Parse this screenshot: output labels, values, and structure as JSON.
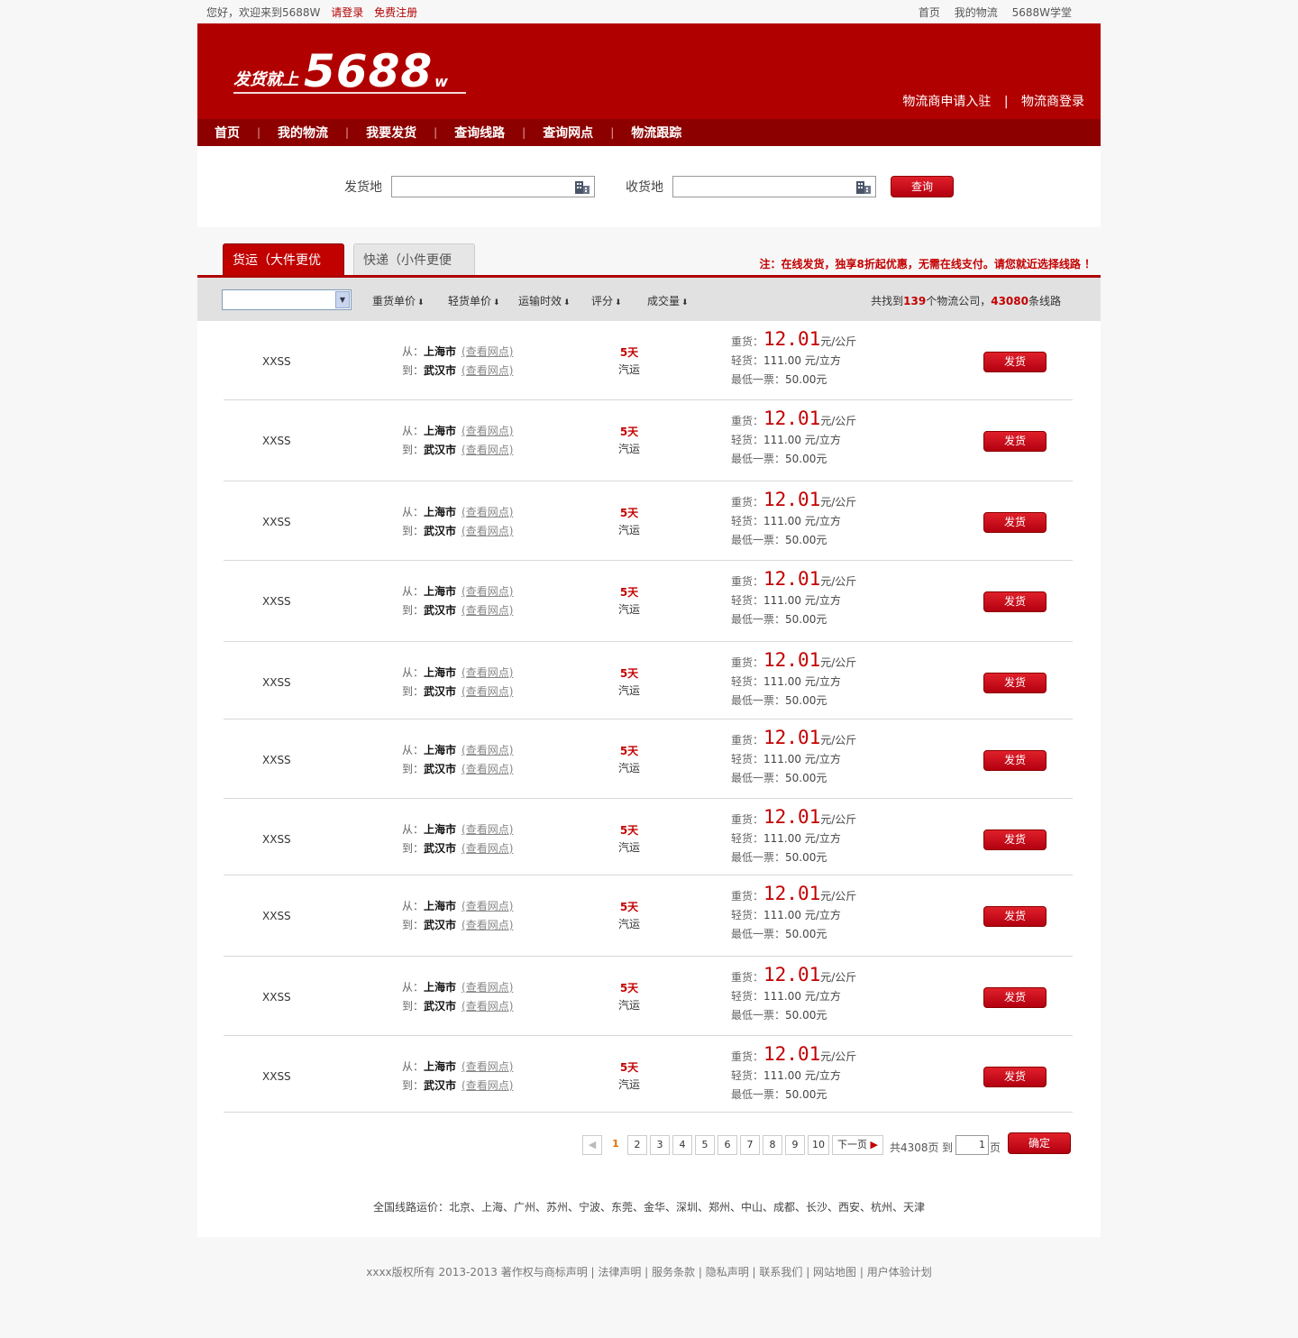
{
  "topbar": {
    "welcome": "您好，欢迎来到5688W",
    "login": "请登录",
    "register": "免费注册",
    "links": [
      "首页",
      "我的物流",
      "5688W学堂"
    ]
  },
  "header": {
    "logo_text": "发货就上",
    "logo_num": "5688",
    "logo_w": "w",
    "vendor_apply": "物流商申请入驻",
    "vendor_sep": "|",
    "vendor_login": "物流商登录"
  },
  "nav": {
    "items": [
      "首页",
      "我的物流",
      "我要发货",
      "查询线路",
      "查询网点",
      "物流跟踪"
    ]
  },
  "search": {
    "from_label": "发货地",
    "to_label": "收货地",
    "button": "查询"
  },
  "tabs": {
    "active": "货运（大件更优惠）",
    "inactive": "快递（小件更便捷）",
    "notice": "注：在线发货，独享8折起优惠，无需在线支付。请您就近选择线路 ！"
  },
  "filter": {
    "sorts": [
      "重货单价",
      "轻货单价",
      "运输时效",
      "评分",
      "成交量"
    ],
    "found_prefix": "共找到",
    "companies": "139",
    "found_mid": "个物流公司，",
    "routes": "43080",
    "found_suffix": "条线路"
  },
  "labels": {
    "from": "从：",
    "to": "到：",
    "view": "(查看网点)",
    "heavy": "重货：",
    "light": "轻货：",
    "min": "最低一票：",
    "ship": "发货"
  },
  "rows": [
    {
      "company": "XXSS",
      "from": "上海市",
      "to": "武汉市",
      "days": "5天",
      "mode": "汽运",
      "heavy": "12.01",
      "heavy_unit": "元/公斤",
      "light": "111.00 元/立方",
      "min": "50.00元"
    },
    {
      "company": "XXSS",
      "from": "上海市",
      "to": "武汉市",
      "days": "5天",
      "mode": "汽运",
      "heavy": "12.01",
      "heavy_unit": "元/公斤",
      "light": "111.00 元/立方",
      "min": "50.00元"
    },
    {
      "company": "XXSS",
      "from": "上海市",
      "to": "武汉市",
      "days": "5天",
      "mode": "汽运",
      "heavy": "12.01",
      "heavy_unit": "元/公斤",
      "light": "111.00 元/立方",
      "min": "50.00元"
    },
    {
      "company": "XXSS",
      "from": "上海市",
      "to": "武汉市",
      "days": "5天",
      "mode": "汽运",
      "heavy": "12.01",
      "heavy_unit": "元/公斤",
      "light": "111.00 元/立方",
      "min": "50.00元"
    },
    {
      "company": "XXSS",
      "from": "上海市",
      "to": "武汉市",
      "days": "5天",
      "mode": "汽运",
      "heavy": "12.01",
      "heavy_unit": "元/公斤",
      "light": "111.00 元/立方",
      "min": "50.00元"
    },
    {
      "company": "XXSS",
      "from": "上海市",
      "to": "武汉市",
      "days": "5天",
      "mode": "汽运",
      "heavy": "12.01",
      "heavy_unit": "元/公斤",
      "light": "111.00 元/立方",
      "min": "50.00元"
    },
    {
      "company": "XXSS",
      "from": "上海市",
      "to": "武汉市",
      "days": "5天",
      "mode": "汽运",
      "heavy": "12.01",
      "heavy_unit": "元/公斤",
      "light": "111.00 元/立方",
      "min": "50.00元"
    },
    {
      "company": "XXSS",
      "from": "上海市",
      "to": "武汉市",
      "days": "5天",
      "mode": "汽运",
      "heavy": "12.01",
      "heavy_unit": "元/公斤",
      "light": "111.00 元/立方",
      "min": "50.00元"
    },
    {
      "company": "XXSS",
      "from": "上海市",
      "to": "武汉市",
      "days": "5天",
      "mode": "汽运",
      "heavy": "12.01",
      "heavy_unit": "元/公斤",
      "light": "111.00 元/立方",
      "min": "50.00元"
    },
    {
      "company": "XXSS",
      "from": "上海市",
      "to": "武汉市",
      "days": "5天",
      "mode": "汽运",
      "heavy": "12.01",
      "heavy_unit": "元/公斤",
      "light": "111.00 元/立方",
      "min": "50.00元"
    }
  ],
  "pager": {
    "pages": [
      "1",
      "2",
      "3",
      "4",
      "5",
      "6",
      "7",
      "8",
      "9",
      "10"
    ],
    "current": "1",
    "next": "下一页",
    "total": "共4308页",
    "goto": "到",
    "page_value": "1",
    "page_unit": "页",
    "ok": "确定"
  },
  "cities": {
    "label": "全国线路运价：",
    "list": "北京、上海、广州、苏州、宁波、东莞、金华、深圳、郑州、中山、成都、长沙、西安、杭州、天津"
  },
  "footer": {
    "text": "xxxx版权所有 2013-2013 著作权与商标声明 | 法律声明 | 服务条款 | 隐私声明 | 联系我们 | 网站地图 | 用户体验计划"
  },
  "colors": {
    "brand_red": "#b10000",
    "nav_dark_red": "#8d0000",
    "price_red": "#c40000"
  }
}
